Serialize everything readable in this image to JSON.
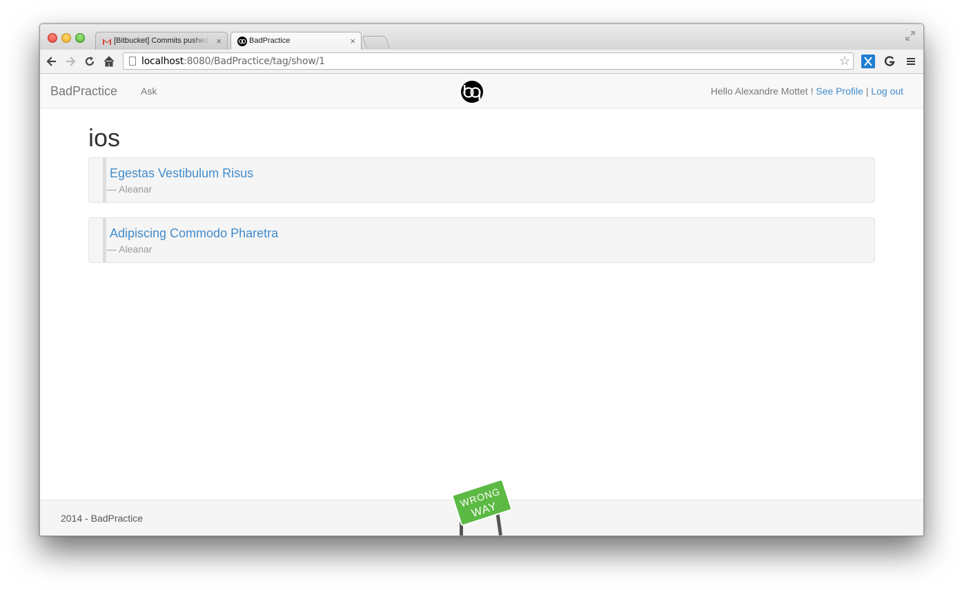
{
  "browser": {
    "tabs": [
      {
        "label": "[Bitbucket] Commits pushed",
        "icon": "gmail-icon",
        "active": false
      },
      {
        "label": "BadPractice",
        "icon": "badpractice-logo-icon",
        "active": true
      }
    ],
    "url_host": "localhost",
    "url_rest": ":8080/BadPractice/tag/show/1"
  },
  "navbar": {
    "brand": "BadPractice",
    "ask": "Ask",
    "greeting": "Hello Alexandre Mottet !",
    "see_profile": "See Profile",
    "separator": "|",
    "logout": "Log out"
  },
  "main": {
    "heading": "ios",
    "questions": [
      {
        "title": "Egestas Vestibulum Risus",
        "author": "— Aleanar"
      },
      {
        "title": "Adipiscing Commodo Pharetra",
        "author": "— Aleanar"
      }
    ]
  },
  "footer": {
    "text": "2014 - BadPractice",
    "sign_line1": "WRONG",
    "sign_line2": "WAY"
  },
  "colors": {
    "link": "#428bca",
    "sign_green": "#5cb944"
  }
}
